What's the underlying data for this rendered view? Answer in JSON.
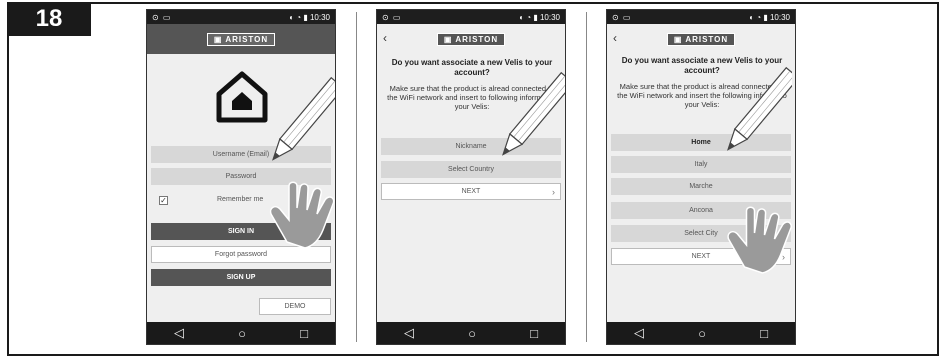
{
  "step_number": "18",
  "status_time": "10:30",
  "brand": "ARISTON",
  "screen1": {
    "username": "Username (Email)",
    "password": "Password",
    "remember": "Remember me",
    "signin": "SIGN IN",
    "forgot": "Forgot password",
    "signup": "SIGN UP",
    "demo": "DEMO"
  },
  "screen2": {
    "question": "Do you want associate a new Velis to your account?",
    "instruction": "Make sure that the product is alread connected to the WiFi network and insert to following information your Velis:",
    "nickname": "Nickname",
    "country": "Select Country",
    "next": "NEXT"
  },
  "screen3": {
    "question": "Do you want associate a new Velis to your account?",
    "instruction": "Make sure that the product is alread connected to the WiFi network and insert the following informatio your Velis:",
    "nickname": "Home",
    "country": "Italy",
    "province": "Marche",
    "city": "Ancona",
    "select_city": "Select City",
    "next": "NEXT"
  },
  "nav_icons": [
    "back-triangle",
    "home-circle",
    "recents-square"
  ]
}
